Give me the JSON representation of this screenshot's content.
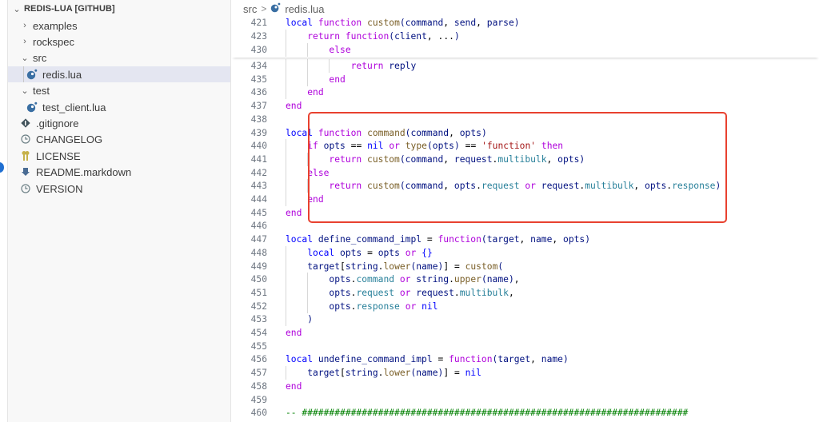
{
  "explorer": {
    "root_label": "REDIS-LUA [GITHUB]",
    "items": [
      {
        "label": "examples",
        "type": "folder",
        "expanded": false
      },
      {
        "label": "rockspec",
        "type": "folder",
        "expanded": false
      },
      {
        "label": "src",
        "type": "folder",
        "expanded": true
      },
      {
        "label": "redis.lua",
        "type": "lua-file",
        "selected": true
      },
      {
        "label": "test",
        "type": "folder",
        "expanded": true
      },
      {
        "label": "test_client.lua",
        "type": "lua-file"
      },
      {
        "label": ".gitignore",
        "type": "git-file"
      },
      {
        "label": "CHANGELOG",
        "type": "clock-file"
      },
      {
        "label": "LICENSE",
        "type": "license-file"
      },
      {
        "label": "README.markdown",
        "type": "markdown-file"
      },
      {
        "label": "VERSION",
        "type": "clock-file"
      }
    ]
  },
  "breadcrumb": {
    "folder": "src",
    "separator": ">",
    "file": "redis.lua"
  },
  "sticky_lines": [
    {
      "n": "421",
      "code": "local function custom(command, send, parse)"
    },
    {
      "n": "423",
      "code": "    return function(client, ...)"
    },
    {
      "n": "430",
      "code": "        else"
    }
  ],
  "lines": [
    {
      "n": "434",
      "code": "            return reply"
    },
    {
      "n": "435",
      "code": "        end"
    },
    {
      "n": "436",
      "code": "    end"
    },
    {
      "n": "437",
      "code": "end"
    },
    {
      "n": "438",
      "code": ""
    },
    {
      "n": "439",
      "code": "local function command(command, opts)"
    },
    {
      "n": "440",
      "code": "    if opts == nil or type(opts) == 'function' then"
    },
    {
      "n": "441",
      "code": "        return custom(command, request.multibulk, opts)"
    },
    {
      "n": "442",
      "code": "    else"
    },
    {
      "n": "443",
      "code": "        return custom(command, opts.request or request.multibulk, opts.response)"
    },
    {
      "n": "444",
      "code": "    end"
    },
    {
      "n": "445",
      "code": "end"
    },
    {
      "n": "446",
      "code": ""
    },
    {
      "n": "447",
      "code": "local define_command_impl = function(target, name, opts)"
    },
    {
      "n": "448",
      "code": "    local opts = opts or {}"
    },
    {
      "n": "449",
      "code": "    target[string.lower(name)] = custom("
    },
    {
      "n": "450",
      "code": "        opts.command or string.upper(name),"
    },
    {
      "n": "451",
      "code": "        opts.request or request.multibulk,"
    },
    {
      "n": "452",
      "code": "        opts.response or nil"
    },
    {
      "n": "453",
      "code": "    )"
    },
    {
      "n": "454",
      "code": "end"
    },
    {
      "n": "455",
      "code": ""
    },
    {
      "n": "456",
      "code": "local undefine_command_impl = function(target, name)"
    },
    {
      "n": "457",
      "code": "    target[string.lower(name)] = nil"
    },
    {
      "n": "458",
      "code": "end"
    },
    {
      "n": "459",
      "code": ""
    },
    {
      "n": "460",
      "code": "-- #######################################################################"
    }
  ],
  "annotation": {
    "highlight_color": "#e8412f",
    "highlighted_lines": [
      "438",
      "445"
    ]
  }
}
